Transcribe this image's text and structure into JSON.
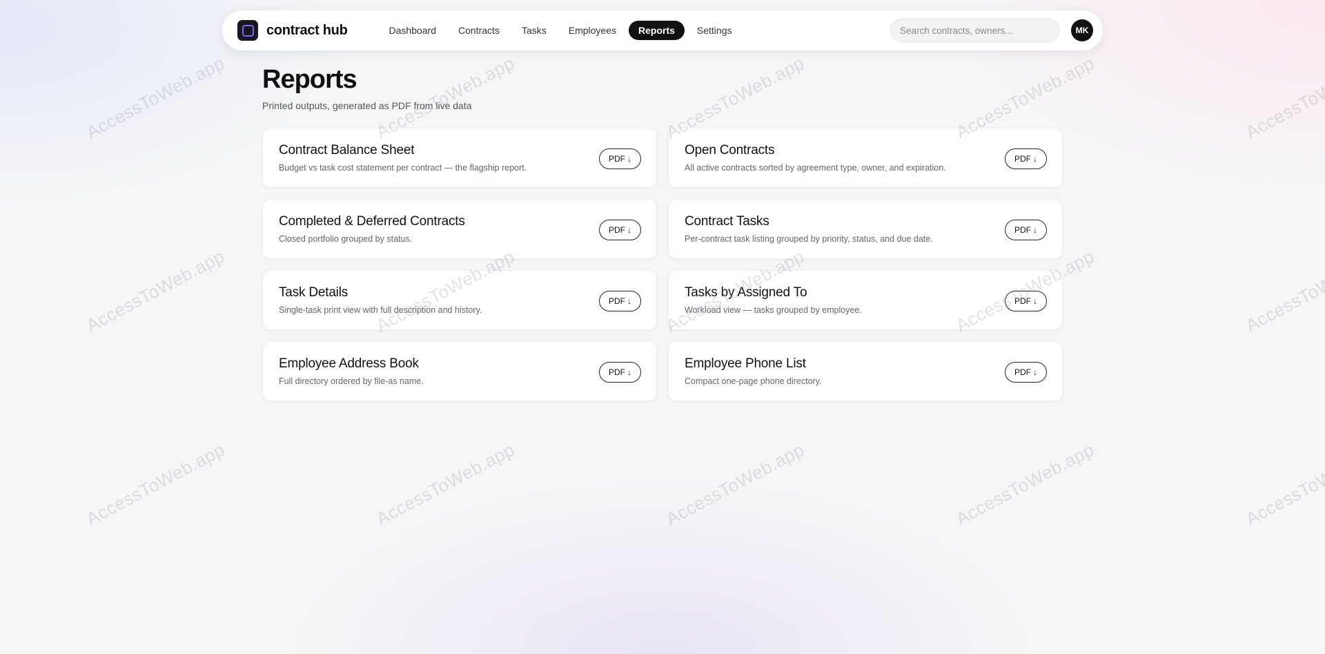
{
  "app": {
    "name": "contract hub",
    "logo_icon": "app-logo-icon"
  },
  "nav": {
    "items": [
      {
        "label": "Dashboard",
        "active": false
      },
      {
        "label": "Contracts",
        "active": false
      },
      {
        "label": "Tasks",
        "active": false
      },
      {
        "label": "Employees",
        "active": false
      },
      {
        "label": "Reports",
        "active": true
      },
      {
        "label": "Settings",
        "active": false
      }
    ]
  },
  "search": {
    "placeholder": "Search contracts, owners..."
  },
  "user": {
    "initials": "MK"
  },
  "page": {
    "title": "Reports",
    "subtitle": "Printed outputs, generated as PDF from live data"
  },
  "reports": [
    {
      "title": "Contract Balance Sheet",
      "description": "Budget vs task cost statement per contract — the flagship report.",
      "button": "PDF"
    },
    {
      "title": "Open Contracts",
      "description": "All active contracts sorted by agreement type, owner, and expiration.",
      "button": "PDF"
    },
    {
      "title": "Completed & Deferred Contracts",
      "description": "Closed portfolio grouped by status.",
      "button": "PDF"
    },
    {
      "title": "Contract Tasks",
      "description": "Per-contract task listing grouped by priority, status, and due date.",
      "button": "PDF"
    },
    {
      "title": "Task Details",
      "description": "Single-task print view with full description and history.",
      "button": "PDF"
    },
    {
      "title": "Tasks by Assigned To",
      "description": "Workload view — tasks grouped by employee.",
      "button": "PDF"
    },
    {
      "title": "Employee Address Book",
      "description": "Full directory ordered by file-as name.",
      "button": "PDF"
    },
    {
      "title": "Employee Phone List",
      "description": "Compact one-page phone directory.",
      "button": "PDF"
    }
  ],
  "icons": {
    "download": "download-arrow-icon",
    "arrow_glyph": "↓"
  },
  "watermark": {
    "text": "AccessToWeb.app"
  },
  "colors": {
    "accent": "#7a68e8",
    "active_nav_bg": "#111111",
    "background": "#f6f6f7"
  }
}
